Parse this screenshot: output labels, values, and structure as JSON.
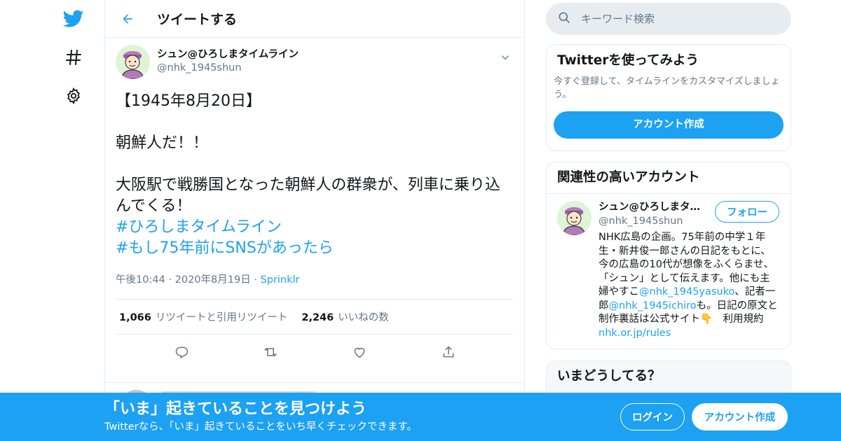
{
  "nav": {
    "icons": [
      "twitter-logo-icon",
      "hashtag-icon",
      "settings-gear-icon"
    ]
  },
  "header": {
    "title": "ツイートする"
  },
  "tweet": {
    "display_name": "シュン@ひろしまタイムライン",
    "handle": "@nhk_1945shun",
    "text": "【1945年8月20日】\n\n朝鮮人だ！！\n\n大阪駅で戦勝国となった朝鮮人の群衆が、列車に乗り込んでくる！\n",
    "hashtags": [
      "#ひろしまタイムライン",
      "#もし75年前にSNSがあったら"
    ],
    "time": "午後10:44",
    "date": "2020年8月19日",
    "source": "Sprinklr",
    "retweets_count": "1,066",
    "retweets_label": "リツイートと引用リツイート",
    "likes_count": "2,246",
    "likes_label": "いいねの数"
  },
  "search": {
    "placeholder": "キーワード検索"
  },
  "try_card": {
    "title": "Twitterを使ってみよう",
    "desc": "今すぐ登録して、タイムラインをカスタマイズしましょう。",
    "button": "アカウント作成"
  },
  "related": {
    "title": "関連性の高いアカウント",
    "name": "シュン@ひろしまタ…",
    "handle": "@nhk_1945shun",
    "follow_label": "フォロー",
    "bio_1": "NHK広島の企画。75年前の中学１年生・新井俊一郎さんの日記をもとに、今の広島の10代が想像をふくらませ、「シュン」として伝えます。他にも主婦やすこ",
    "bio_link_1": "@nhk_1945yasuko",
    "bio_2": "、記者一郎",
    "bio_link_2": "@nhk_1945ichiro",
    "bio_3": "も。日記の原文と制作裏話は公式サイト👇　利用規約",
    "bio_link_3": "nhk.or.jp/rules"
  },
  "now_card": {
    "title": "いまどうしてる？"
  },
  "banner": {
    "title": "「いま」起きていることを見つけよう",
    "subtitle": "Twitterなら、「いま」起きていることをいち早くチェックできます。",
    "login": "ログイン",
    "signup": "アカウント作成"
  },
  "colors": {
    "accent": "#1da1f2",
    "text": "#14171a",
    "muted": "#657786",
    "border": "#e6ecf0"
  }
}
